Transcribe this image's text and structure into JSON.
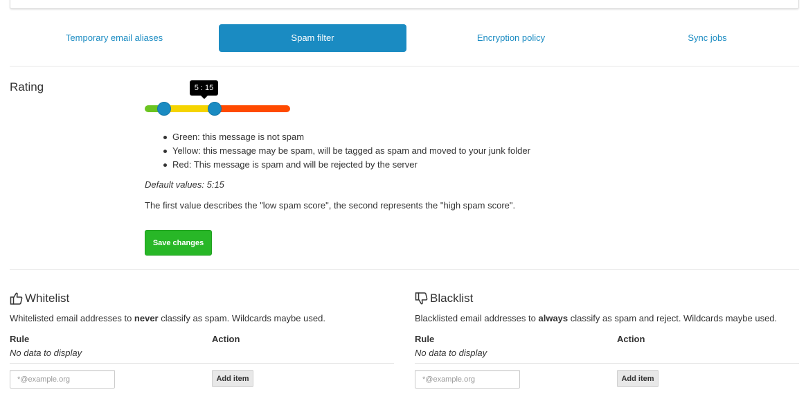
{
  "tabs": [
    {
      "label": "Temporary email aliases",
      "active": false
    },
    {
      "label": "Spam filter",
      "active": true
    },
    {
      "label": "Encryption policy",
      "active": false
    },
    {
      "label": "Sync jobs",
      "active": false
    }
  ],
  "rating": {
    "title": "Rating",
    "slider": {
      "low": 5,
      "high": 15,
      "tooltip": "5 : 15",
      "colors": {
        "green": "#6bc421",
        "yellow": "#f5d400",
        "red": "#ff4a00",
        "handle": "#1a8bc2"
      }
    },
    "legend": [
      "Green: this message is not spam",
      "Yellow: this message may be spam, will be tagged as spam and moved to your junk folder",
      "Red: This message is spam and will be rejected by the server"
    ],
    "defaults": "Default values: 5:15",
    "explanation": "The first value describes the \"low spam score\", the second represents the \"high spam score\".",
    "save_label": "Save changes"
  },
  "whitelist": {
    "title": "Whitelist",
    "icon": "thumbs-up-icon",
    "desc_before": "Whitelisted email addresses to ",
    "desc_bold": "never",
    "desc_after": " classify as spam. Wildcards maybe used.",
    "col_rule": "Rule",
    "col_action": "Action",
    "empty": "No data to display",
    "placeholder": "*@example.org",
    "add_label": "Add item"
  },
  "blacklist": {
    "title": "Blacklist",
    "icon": "thumbs-down-icon",
    "desc_before": "Blacklisted email addresses to ",
    "desc_bold": "always",
    "desc_after": " classify as spam and reject. Wildcards maybe used.",
    "col_rule": "Rule",
    "col_action": "Action",
    "empty": "No data to display",
    "placeholder": "*@example.org",
    "add_label": "Add item"
  },
  "colors": {
    "accent": "#1a8bc2",
    "success": "#28b727"
  }
}
